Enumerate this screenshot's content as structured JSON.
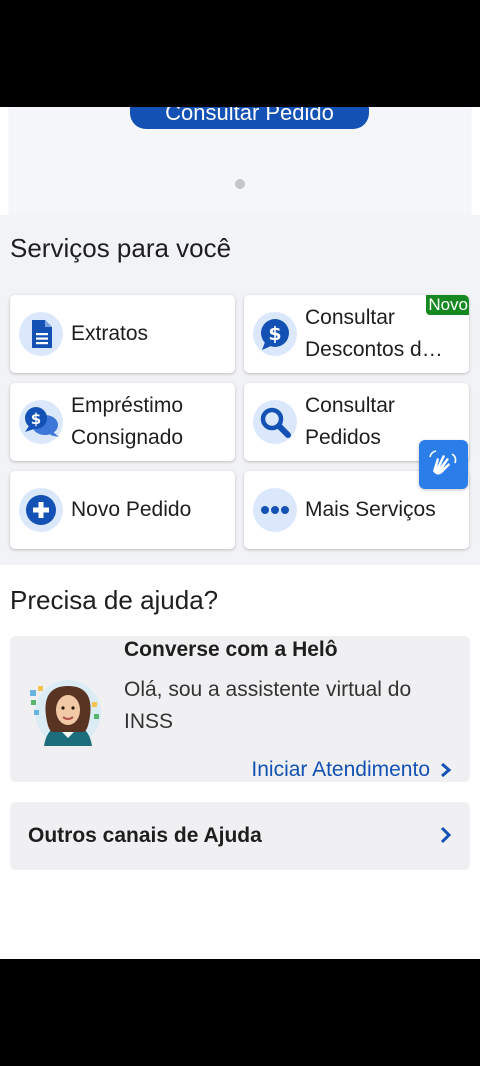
{
  "top_card": {
    "consult_button": "Consultar Pedido"
  },
  "services": {
    "title": "Serviços para você",
    "items": [
      {
        "label": "Extratos",
        "icon": "document-icon"
      },
      {
        "label": "Consultar\nDescontos d…",
        "icon": "dollar-chat-icon",
        "badge": "Novo"
      },
      {
        "label": "Empréstimo\nConsignado",
        "icon": "money-chat-icon"
      },
      {
        "label": "Consultar\nPedidos",
        "icon": "search-icon"
      },
      {
        "label": "Novo Pedido",
        "icon": "plus-circle-icon"
      },
      {
        "label": "Mais Serviços",
        "icon": "more-dots-icon"
      }
    ]
  },
  "help": {
    "title": "Precisa de ajuda?",
    "assistant_title": "Converse com a Helô",
    "assistant_text": "Olá, sou a assistente virtual do INSS",
    "start_link": "Iniciar Atendimento",
    "other_channels": "Outros canais de Ajuda"
  },
  "colors": {
    "primary": "#1351b4",
    "badge": "#168821",
    "libras": "#2b7de9",
    "icon_bg": "#dbe8fb"
  }
}
